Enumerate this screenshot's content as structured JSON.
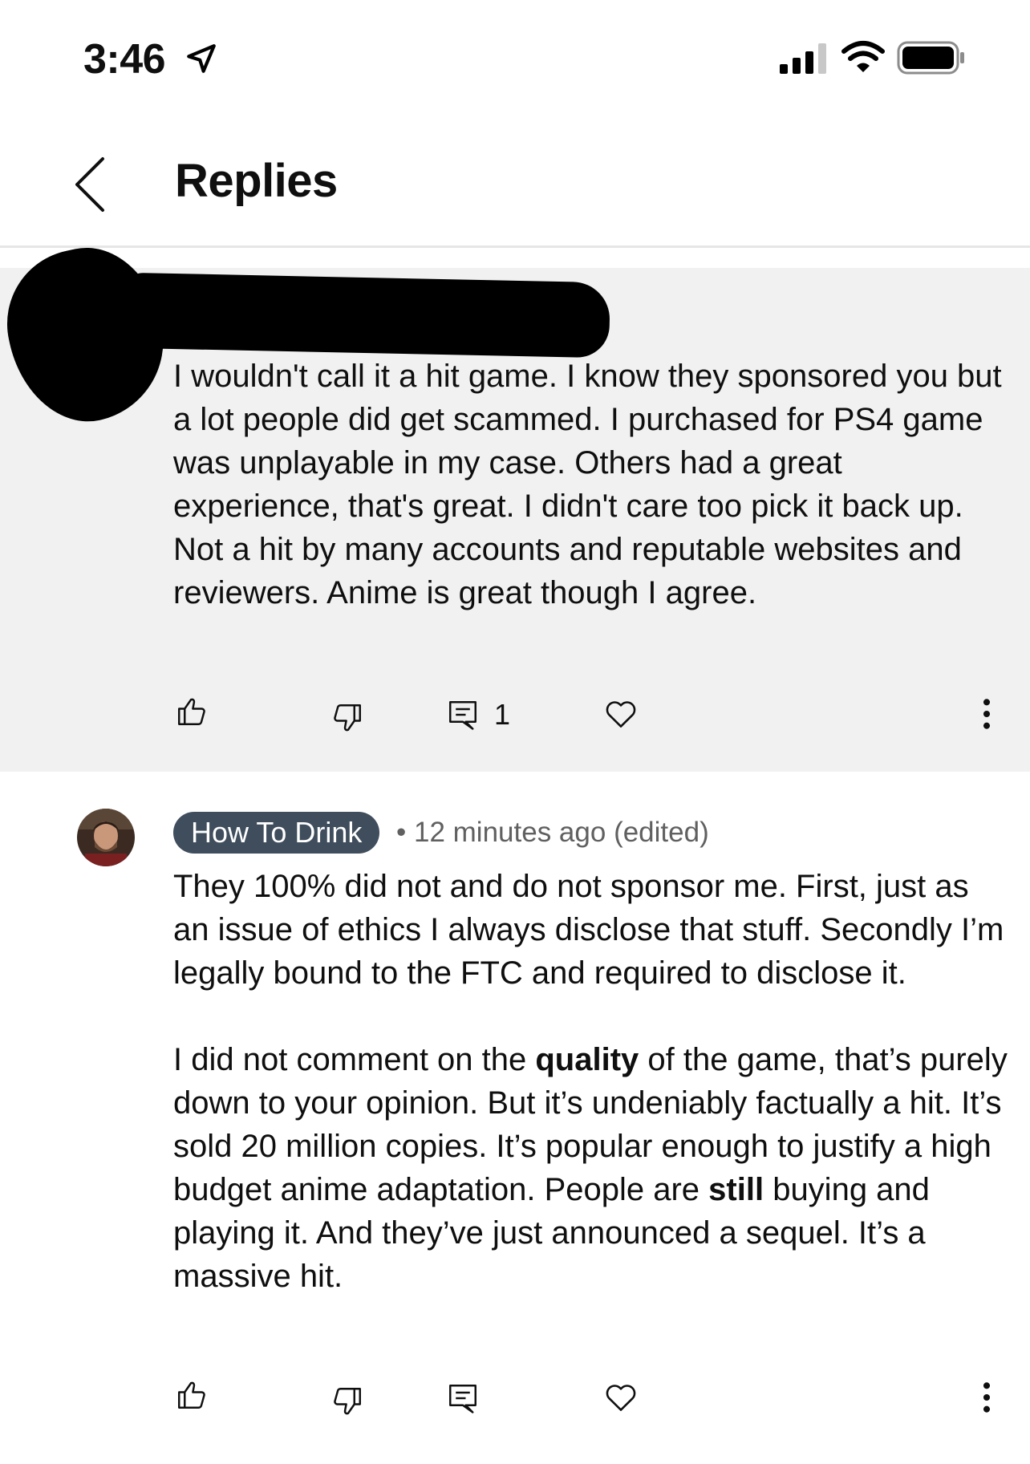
{
  "status_bar": {
    "time": "3:46"
  },
  "header": {
    "title": "Replies"
  },
  "parent_comment": {
    "text": "I wouldn't call it a hit game. I know they sponsored you but a lot people did get scammed. I purchased for PS4 game was unplayable in my case. Others had a great experience, that's great. I didn't care too pick it back up. Not a hit by many accounts and reputable websites and reviewers.  Anime is great though I agree.",
    "reply_count": "1"
  },
  "reply": {
    "author": "How To Drink",
    "separator": "•",
    "time": "12 minutes ago",
    "edited": "(edited)",
    "p1": "They 100% did not and do not sponsor me. First, just as an issue of ethics I always disclose that stuff. Secondly I’m legally bound to the FTC and required to disclose it.",
    "p2_a": "I did not comment on the ",
    "p2_b": "quality",
    "p2_c": " of the game, that’s purely down to your opinion. But it’s undeniably factually a hit. It’s sold 20 million copies. It’s popular enough to justify a high budget anime adaptation. People are ",
    "p2_d": "still",
    "p2_e": " buying and playing it. And they’ve just announced a sequel. It’s a massive hit."
  }
}
